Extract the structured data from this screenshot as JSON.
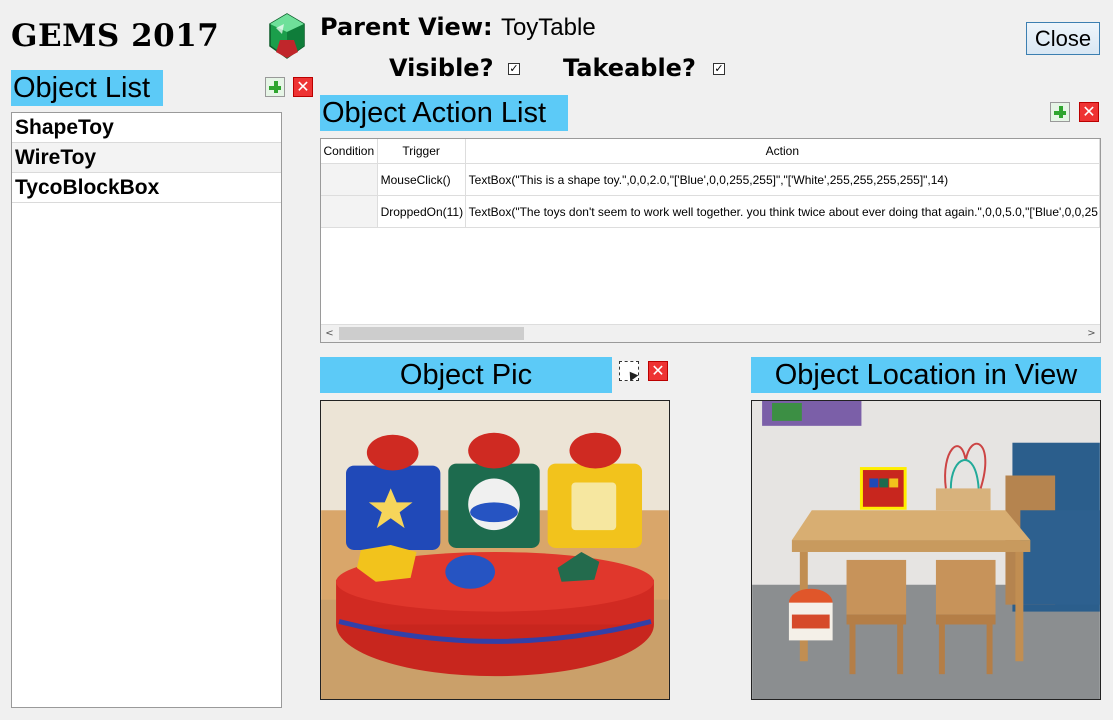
{
  "app": {
    "title": "GEMS 2017"
  },
  "header": {
    "parent_view_label": "Parent View:",
    "parent_view_value": "ToyTable",
    "close_label": "Close",
    "visible_label": "Visible?",
    "visible_checked": true,
    "takeable_label": "Takeable?",
    "takeable_checked": true
  },
  "object_list": {
    "title": "Object List",
    "items": [
      "ShapeToy",
      "WireToy",
      "TycoBlockBox"
    ]
  },
  "action_list": {
    "title": "Object Action List",
    "columns": [
      "Condition",
      "Trigger",
      "Action"
    ],
    "rows": [
      {
        "condition": "",
        "trigger": "MouseClick()",
        "action": "TextBox(\"This is a shape toy.\",0,0,2.0,\"['Blue',0,0,255,255]\",\"['White',255,255,255,255]\",14)"
      },
      {
        "condition": "",
        "trigger": "DroppedOn(11)",
        "action": "TextBox(\"The toys don't seem to work well together. you think twice about ever doing that again.\",0,0,5.0,\"['Blue',0,0,25"
      }
    ]
  },
  "object_pic": {
    "title": "Object Pic"
  },
  "object_location": {
    "title": "Object Location in View"
  },
  "icons": {
    "add": "add-icon",
    "delete": "delete-icon",
    "select_region": "select-region-icon",
    "app_logo": "gem-icon"
  },
  "colors": {
    "section_header": "#5ccaf7",
    "add": "#2fa52f",
    "delete": "#e33333",
    "highlight_box": "#ffee00"
  }
}
